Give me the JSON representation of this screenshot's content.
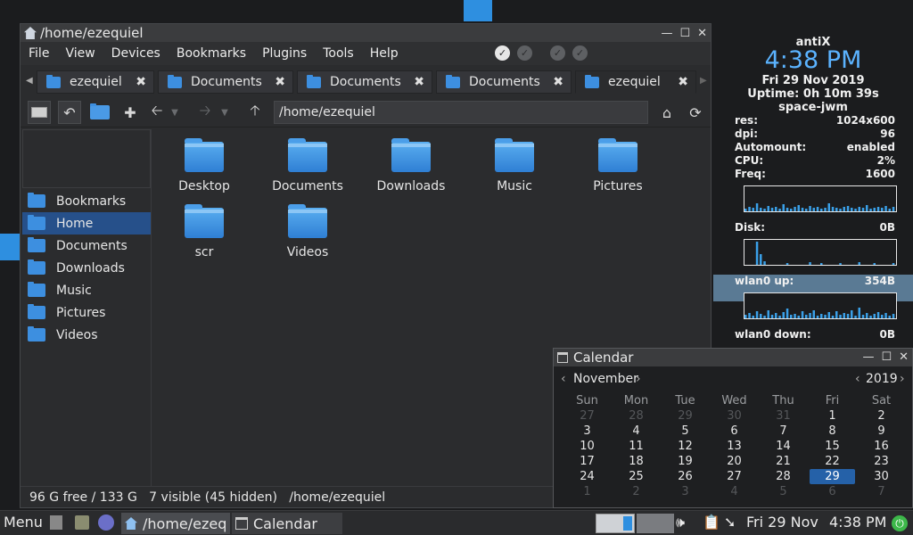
{
  "file_manager": {
    "title": "/home/ezequiel",
    "menu": [
      "File",
      "View",
      "Devices",
      "Bookmarks",
      "Plugins",
      "Tools",
      "Help"
    ],
    "tabs": [
      "ezequiel",
      "Documents",
      "Documents",
      "Documents",
      "ezequiel"
    ],
    "active_tab": 4,
    "path": "/home/ezequiel",
    "sidebar": [
      "Bookmarks",
      "Home",
      "Documents",
      "Downloads",
      "Music",
      "Pictures",
      "Videos"
    ],
    "selected_sidebar": "Home",
    "files": [
      "Desktop",
      "Documents",
      "Downloads",
      "Music",
      "Pictures",
      "scr",
      "Videos"
    ],
    "status": {
      "free": "96 G free / 133 G",
      "visible": "7 visible (45 hidden)",
      "path": "/home/ezequiel"
    }
  },
  "conky": {
    "distro": "antiX",
    "time": "4:38 PM",
    "date": "Fri 29 Nov 2019",
    "uptime": "Uptime: 0h 10m 39s",
    "wm": "space-jwm",
    "stats": [
      {
        "label": "res:",
        "value": "1024x600"
      },
      {
        "label": "dpi:",
        "value": "96"
      },
      {
        "label": "Automount:",
        "value": "enabled"
      },
      {
        "label": "CPU:",
        "value": "2%"
      },
      {
        "label": "Freq:",
        "value": "1600"
      }
    ],
    "disk": {
      "label": "Disk:",
      "value": "0B"
    },
    "wlan_up": {
      "label": "wlan0 up:",
      "value": "354B"
    },
    "wlan_down": {
      "label": "wlan0 down:",
      "value": "0B"
    },
    "graph_color": "#3aa0e8"
  },
  "calendar": {
    "title": "Calendar",
    "month": "November",
    "year": "2019",
    "weekdays": [
      "Sun",
      "Mon",
      "Tue",
      "Wed",
      "Thu",
      "Fri",
      "Sat"
    ],
    "weeks": [
      [
        "27",
        "28",
        "29",
        "30",
        "31",
        "1",
        "2"
      ],
      [
        "3",
        "4",
        "5",
        "6",
        "7",
        "8",
        "9"
      ],
      [
        "10",
        "11",
        "12",
        "13",
        "14",
        "15",
        "16"
      ],
      [
        "17",
        "18",
        "19",
        "20",
        "21",
        "22",
        "23"
      ],
      [
        "24",
        "25",
        "26",
        "27",
        "28",
        "29",
        "30"
      ],
      [
        "1",
        "2",
        "3",
        "4",
        "5",
        "6",
        "7"
      ]
    ],
    "today": "29"
  },
  "taskbar": {
    "menu": "Menu",
    "tasks": [
      "/home/ezeq",
      "Calendar"
    ],
    "clock_date": "Fri 29 Nov",
    "clock_time": "4:38 PM"
  }
}
